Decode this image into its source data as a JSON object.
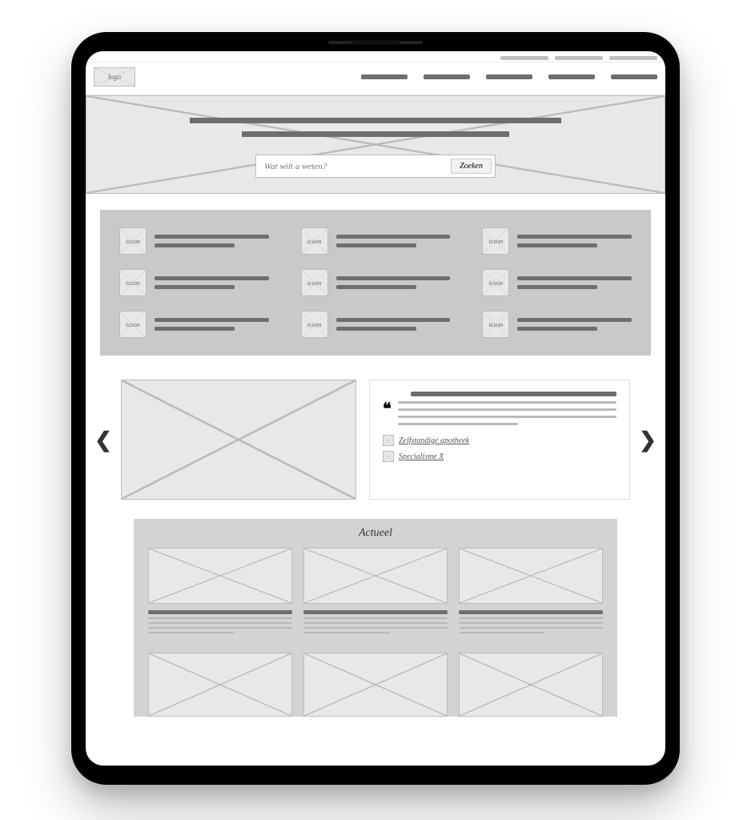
{
  "header": {
    "logo_label": "logo",
    "utility_links": [
      "",
      "",
      ""
    ],
    "nav_items": [
      "",
      "",
      "",
      "",
      ""
    ]
  },
  "hero": {
    "search_placeholder": "Wat wilt u weten?",
    "search_button": "Zoeken"
  },
  "tiles": {
    "icon_label": "icoon",
    "items": [
      "",
      "",
      "",
      "",
      "",
      "",
      "",
      "",
      ""
    ]
  },
  "carousel": {
    "tags": [
      {
        "label": "Zelfstandige apotheek"
      },
      {
        "label": "Specialisme X"
      }
    ]
  },
  "news": {
    "title": "Actueel",
    "cards": [
      "",
      "",
      "",
      "",
      "",
      ""
    ]
  }
}
